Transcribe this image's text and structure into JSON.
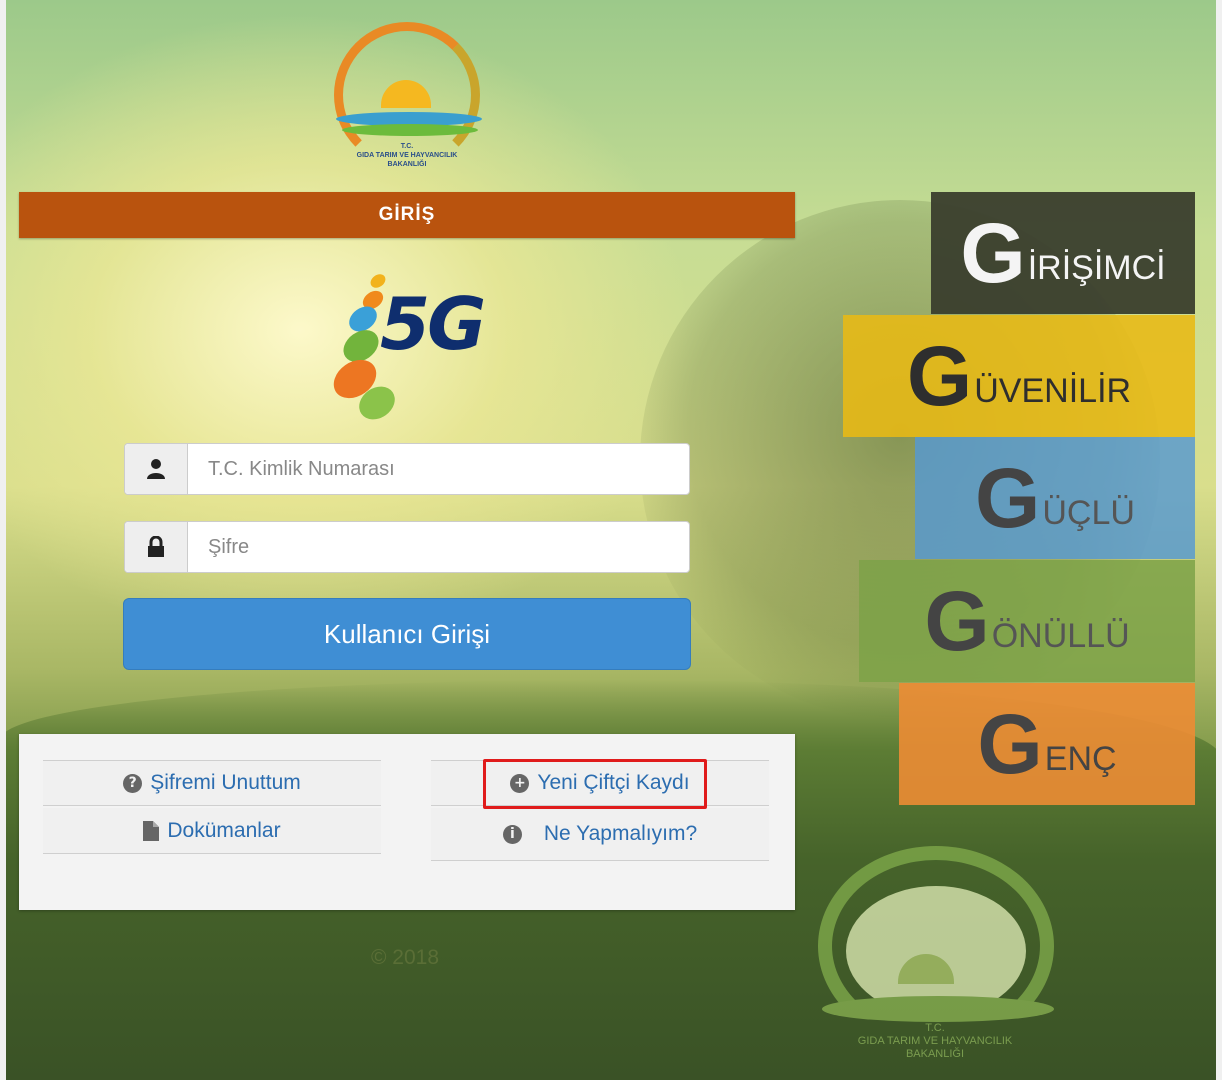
{
  "ministry_logo": {
    "line1": "T.C.",
    "line2": "GIDA TARIM VE HAYVANCILIK",
    "line3": "BAKANLIĞI"
  },
  "login": {
    "header": "GİRİŞ",
    "logo_text": "5G",
    "tc_placeholder": "T.C. Kimlik Numarası",
    "password_placeholder": "Şifre",
    "submit_label": "Kullanıcı Girişi"
  },
  "links": {
    "forgot_password": "Şifremi Unuttum",
    "documents": "Dokümanlar",
    "new_farmer": "Yeni Çiftçi Kaydı",
    "what_to_do": "Ne Yapmalıyım?"
  },
  "footer": {
    "copyright": "© 2018"
  },
  "tiles": [
    {
      "big": "G",
      "rest": "İRİŞİMCİ"
    },
    {
      "big": "G",
      "rest": "ÜVENİLİR"
    },
    {
      "big": "G",
      "rest": "ÜÇLÜ"
    },
    {
      "big": "G",
      "rest": "ÖNÜLLÜ"
    },
    {
      "big": "G",
      "rest": "ENÇ"
    }
  ],
  "colors": {
    "header_bg": "#b9530e",
    "button_bg": "#3f8ed4",
    "link": "#2c6db0",
    "highlight": "#e01b1b"
  },
  "icons": {
    "tc_field": "user-icon",
    "password_field": "lock-icon",
    "forgot_password": "question-circle-icon",
    "documents": "file-icon",
    "new_farmer": "plus-circle-icon",
    "what_to_do": "info-circle-icon"
  }
}
